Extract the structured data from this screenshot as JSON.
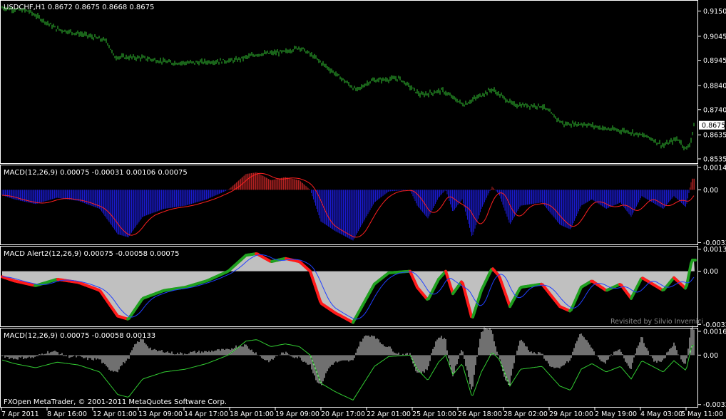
{
  "chart_data": [
    {
      "type": "bar",
      "title": "USDCHF,H1  0.8672 0.8675 0.8668 0.8675",
      "ylim": [
        0.852,
        0.919
      ],
      "y_ticks": [
        "0.9150",
        "0.9045",
        "0.8945",
        "0.8840",
        "0.8740",
        "0.8635",
        "0.8535"
      ],
      "y_tick_values": [
        0.915,
        0.9045,
        0.8945,
        0.884,
        0.874,
        0.8635,
        0.8535
      ],
      "last_price": "0.8675",
      "last_price_value": 0.8675,
      "price_color": "#34c834",
      "price_anchors": [
        [
          0,
          0.9165
        ],
        [
          40,
          0.915
        ],
        [
          80,
          0.9075
        ],
        [
          120,
          0.905
        ],
        [
          150,
          0.9025
        ],
        [
          160,
          0.896
        ],
        [
          200,
          0.8955
        ],
        [
          240,
          0.8935
        ],
        [
          270,
          0.8935
        ],
        [
          300,
          0.894
        ],
        [
          330,
          0.8945
        ],
        [
          360,
          0.897
        ],
        [
          400,
          0.898
        ],
        [
          420,
          0.9
        ],
        [
          440,
          0.896
        ],
        [
          470,
          0.889
        ],
        [
          500,
          0.882
        ],
        [
          520,
          0.886
        ],
        [
          560,
          0.887
        ],
        [
          590,
          0.88
        ],
        [
          620,
          0.882
        ],
        [
          650,
          0.876
        ],
        [
          690,
          0.8825
        ],
        [
          720,
          0.876
        ],
        [
          760,
          0.8755
        ],
        [
          790,
          0.868
        ],
        [
          820,
          0.868
        ],
        [
          850,
          0.866
        ],
        [
          880,
          0.865
        ],
        [
          910,
          0.8625
        ],
        [
          930,
          0.859
        ],
        [
          950,
          0.862
        ],
        [
          962,
          0.8575
        ],
        [
          968,
          0.86
        ],
        [
          973,
          0.8675
        ]
      ]
    },
    {
      "type": "bar",
      "title": "MACD(12,26,9) 0.00075 -0.00031 0.00106 0.00075",
      "ylim": [
        -0.0034,
        0.0015
      ],
      "y_ticks": [
        "0.00141",
        "0.00",
        "-0.00333"
      ],
      "y_tick_values": [
        0.00141,
        0.0,
        -0.00333
      ],
      "hist_pos_color": "#b22222",
      "hist_neg_color": "#1a1acd",
      "signal_color": "#ff2020"
    },
    {
      "type": "area",
      "title": "MACD Alert2(12,26,9) 0.00075 -0.00058 0.00075",
      "ylim": [
        -0.0034,
        0.0015
      ],
      "y_ticks": [
        "0.00138",
        "0.00",
        "-0.00333"
      ],
      "y_tick_values": [
        0.00138,
        0.0,
        -0.00333
      ],
      "fill_color": "#c0c0c0",
      "up_color": "#1fa01f",
      "down_color": "#ff1a1a",
      "signal_color": "#2040ff",
      "watermark": "Revisited by Silvio Invernici"
    },
    {
      "type": "bar",
      "title": "MACD(12,26,9) 0.00075 -0.00058 0.00133",
      "ylim": [
        -0.00345,
        0.00175
      ],
      "y_ticks": [
        "0.00161",
        "0.00",
        "-0.00334"
      ],
      "y_tick_values": [
        0.00161,
        0.0,
        -0.00334
      ],
      "hist_color": "#e0e0e0",
      "line_color": "#32cd32"
    }
  ],
  "macd_anchors": [
    [
      0,
      -0.0003
    ],
    [
      20,
      -0.0006
    ],
    [
      50,
      -0.0009
    ],
    [
      80,
      -0.0005
    ],
    [
      110,
      -0.0007
    ],
    [
      140,
      -0.0012
    ],
    [
      165,
      -0.0028
    ],
    [
      180,
      -0.003
    ],
    [
      200,
      -0.0017
    ],
    [
      230,
      -0.0012
    ],
    [
      260,
      -0.001
    ],
    [
      290,
      -0.0006
    ],
    [
      320,
      0.0
    ],
    [
      345,
      0.001
    ],
    [
      360,
      0.0011
    ],
    [
      380,
      0.0006
    ],
    [
      400,
      0.0008
    ],
    [
      420,
      0.0006
    ],
    [
      435,
      0.0
    ],
    [
      450,
      -0.002
    ],
    [
      470,
      -0.0026
    ],
    [
      495,
      -0.0032
    ],
    [
      510,
      -0.002
    ],
    [
      525,
      -0.0008
    ],
    [
      545,
      -0.0001
    ],
    [
      575,
      0.0
    ],
    [
      585,
      -0.001
    ],
    [
      600,
      -0.0018
    ],
    [
      615,
      -0.0005
    ],
    [
      625,
      0.0
    ],
    [
      635,
      -0.0014
    ],
    [
      648,
      -0.0006
    ],
    [
      662,
      -0.003
    ],
    [
      675,
      -0.0012
    ],
    [
      690,
      0.0002
    ],
    [
      700,
      -0.0003
    ],
    [
      715,
      -0.0022
    ],
    [
      730,
      -0.001
    ],
    [
      760,
      -0.0008
    ],
    [
      785,
      -0.0022
    ],
    [
      800,
      -0.0025
    ],
    [
      815,
      -0.001
    ],
    [
      830,
      -0.0006
    ],
    [
      850,
      -0.0012
    ],
    [
      870,
      -0.0008
    ],
    [
      885,
      -0.0017
    ],
    [
      900,
      -0.0004
    ],
    [
      915,
      -0.0008
    ],
    [
      930,
      -0.0012
    ],
    [
      945,
      -0.0004
    ],
    [
      962,
      -0.0011
    ],
    [
      970,
      0.0007
    ]
  ],
  "x_axis": {
    "labels": [
      "7 Apr 2011",
      "8 Apr 16:00",
      "12 Apr 01:00",
      "13 Apr 09:00",
      "14 Apr 17:00",
      "18 Apr 01:00",
      "19 Apr 09:00",
      "20 Apr 17:00",
      "22 Apr 01:00",
      "25 Apr 10:00",
      "26 Apr 18:00",
      "28 Apr 02:00",
      "29 Apr 10:00",
      "2 May 19:00",
      "4 May 03:00",
      "5 May 11:00"
    ]
  },
  "copyright": "FXOpen MetaTrader, © 2001-2011 MetaQuotes Software Corp.",
  "colors": {
    "background": "#000000",
    "border": "#ffffff"
  }
}
